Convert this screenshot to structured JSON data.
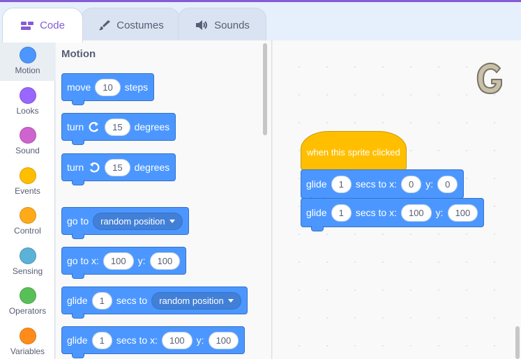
{
  "tabs": [
    {
      "label": "Code",
      "icon": "code-icon"
    },
    {
      "label": "Costumes",
      "icon": "brush-icon"
    },
    {
      "label": "Sounds",
      "icon": "speaker-icon"
    }
  ],
  "categories": [
    {
      "label": "Motion",
      "color": "#4c97ff"
    },
    {
      "label": "Looks",
      "color": "#9966ff"
    },
    {
      "label": "Sound",
      "color": "#cf63cf"
    },
    {
      "label": "Events",
      "color": "#ffbf00"
    },
    {
      "label": "Control",
      "color": "#ffab19"
    },
    {
      "label": "Sensing",
      "color": "#5cb1d6"
    },
    {
      "label": "Operators",
      "color": "#59c059"
    },
    {
      "label": "Variables",
      "color": "#ff8c1a"
    }
  ],
  "palette": {
    "title": "Motion",
    "move": {
      "label": "move",
      "steps": "10",
      "suffix": "steps"
    },
    "turn_right": {
      "label": "turn",
      "degrees": "15",
      "suffix": "degrees"
    },
    "turn_left": {
      "label": "turn",
      "degrees": "15",
      "suffix": "degrees"
    },
    "goto": {
      "label": "go to",
      "target": "random position"
    },
    "goto_xy": {
      "label": "go to x:",
      "x": "100",
      "ylabel": "y:",
      "y": "100"
    },
    "glide_to": {
      "label": "glide",
      "secs": "1",
      "mid": "secs to",
      "target": "random position"
    },
    "glide_xy": {
      "label": "glide",
      "secs": "1",
      "mid": "secs to x:",
      "x": "100",
      "ylabel": "y:",
      "y": "100"
    }
  },
  "workspace": {
    "hat": "when this sprite clicked",
    "glide1": {
      "label": "glide",
      "secs": "1",
      "mid": "secs to x:",
      "x": "0",
      "ylabel": "y:",
      "y": "0"
    },
    "glide2": {
      "label": "glide",
      "secs": "1",
      "mid": "secs to x:",
      "x": "100",
      "ylabel": "y:",
      "y": "100"
    }
  }
}
